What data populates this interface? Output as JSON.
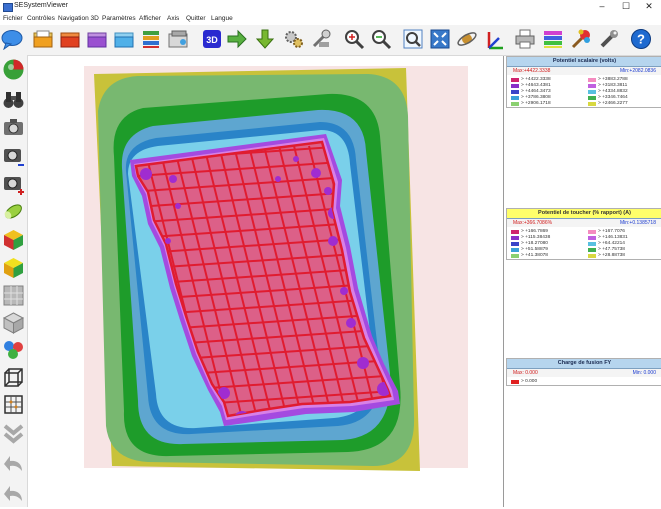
{
  "window": {
    "title": "SESystemViewer",
    "controls": [
      "–",
      "☐",
      "✕"
    ]
  },
  "menu": [
    "Fichier",
    "Contrôles",
    "Navigation 3D",
    "Paramètres",
    "Afficher",
    "Axis",
    "Quitter",
    "Langue"
  ],
  "toolbar_icons": [
    "chat-bubble-icon",
    "open-folder-icon",
    "red-folder-icon",
    "purple-folder-icon",
    "cyan-folder-icon",
    "layers-icon",
    "stack-icon",
    "3d-view-icon",
    "next-arrow-icon",
    "down-arrow-icon",
    "gears-icon",
    "tools-icon",
    "zoom-in-icon",
    "zoom-out-icon",
    "zoom-box-icon",
    "fit-window-icon",
    "orbit-icon",
    "axes-icon",
    "print-icon",
    "palette-icon",
    "paint-icon",
    "wrench-icon",
    "help-icon"
  ],
  "left_icons": [
    "color-sphere-icon",
    "binoculars-icon",
    "camera-icon",
    "camera-minus-icon",
    "camera-plus-icon",
    "eraser-icon",
    "cube-color-icon",
    "cube-yellow-icon",
    "mesh-grey-icon",
    "mesh-grid-icon",
    "spheres-icon",
    "wire-cube-icon",
    "frame-grid-icon",
    "chevrons-down-icon",
    "undo-icon",
    "redo-icon"
  ],
  "legends": [
    {
      "title": "Potentiel scalaire (volts)",
      "max_label": "Max:+4422.3338",
      "min_label": "Min:+2082.0836",
      "left_entries": [
        {
          "color": "#d0246e",
          "text": "> +4422.3338"
        },
        {
          "color": "#8a30c8",
          "text": "> +4643.4381"
        },
        {
          "color": "#3a44c8",
          "text": "> +4464.3473"
        },
        {
          "color": "#3aa0d8",
          "text": "> +3786.3808"
        },
        {
          "color": "#8ad070",
          "text": "> +2906.1718"
        }
      ],
      "right_entries": [
        {
          "color": "#f48cc0",
          "text": "> +3883.2788"
        },
        {
          "color": "#c060e0",
          "text": "> +3183.3811"
        },
        {
          "color": "#58c0e0",
          "text": "> +4334.8832"
        },
        {
          "color": "#40b050",
          "text": "> +3346.7464"
        },
        {
          "color": "#d8d840",
          "text": "> +2466.2277"
        }
      ]
    },
    {
      "title": "Potentiel de toucher (% rapport) (A)",
      "max_label": "Max:+366.7086%",
      "min_label": "Min:+0.1385718",
      "left_entries": [
        {
          "color": "#d0246e",
          "text": "> +166.7869"
        },
        {
          "color": "#8a30c8",
          "text": "> +115.38438"
        },
        {
          "color": "#3a44c8",
          "text": "> +18.27080"
        },
        {
          "color": "#3aa0d8",
          "text": "> +51.58879"
        },
        {
          "color": "#8ad070",
          "text": "> +41.38078"
        }
      ],
      "right_entries": [
        {
          "color": "#f48cc0",
          "text": "> +167.7076"
        },
        {
          "color": "#c060e0",
          "text": "> +146.13831"
        },
        {
          "color": "#58c0e0",
          "text": "> +64.42214"
        },
        {
          "color": "#40b050",
          "text": "> +47.75738"
        },
        {
          "color": "#d8d840",
          "text": "> +28.88738"
        }
      ]
    },
    {
      "title": "Charge de fusion FY",
      "max_label": "Max: 0.000",
      "min_label": "Min: 0.000",
      "left_entries": [
        {
          "color": "#e02020",
          "text": "> 0.000"
        }
      ],
      "right_entries": []
    }
  ],
  "colors": {
    "background": "#f7e4e4",
    "outer_yellow": "#c8c23a",
    "light_green": "#78b870",
    "dark_green": "#1e9c2a",
    "light_blue": "#5ea6d0",
    "mid_blue": "#2a84c8",
    "light_cyan": "#7ad0ea",
    "violet": "#a44ae0",
    "light_violet": "#d880e6",
    "pink_surface": "#dc6088",
    "red_conductor": "#e01c30",
    "purple_hotspot": "#a02cd0"
  }
}
